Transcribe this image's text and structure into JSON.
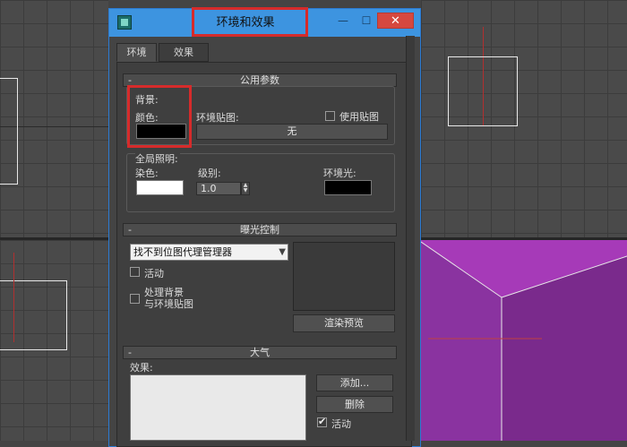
{
  "window": {
    "title": "环境和效果",
    "min_symbol": "—",
    "max_symbol": "☐",
    "close_symbol": "✕"
  },
  "tabs": [
    {
      "label": "环境",
      "active": true
    },
    {
      "label": "效果",
      "active": false
    }
  ],
  "common_params": {
    "header": "公用参数",
    "collapse_symbol": "-",
    "background_label": "背景:",
    "color_label": "颜色:",
    "env_map_label": "环境贴图:",
    "use_map_label": "使用贴图",
    "use_map_checked": false,
    "map_button": "无",
    "bg_color": "#000000",
    "global_lighting_label": "全局照明:",
    "tint_label": "染色:",
    "tint_color": "#ffffff",
    "level_label": "级别:",
    "level_value": "1.0",
    "ambient_label": "环境光:",
    "ambient_color": "#000000"
  },
  "exposure": {
    "header": "曝光控制",
    "collapse_symbol": "-",
    "dropdown_value": "找不到位图代理管理器",
    "active_label": "活动",
    "active_checked": false,
    "process_bg_label_1": "处理背景",
    "process_bg_label_2": "与环境贴图",
    "process_bg_checked": false,
    "render_preview_button": "渲染预览"
  },
  "atmosphere": {
    "header": "大气",
    "collapse_symbol": "-",
    "effects_label": "效果:",
    "add_button": "添加...",
    "delete_button": "删除",
    "active_label": "活动",
    "active_checked": true
  },
  "colors": {
    "titlebar": "#3d94e0",
    "highlight": "#d62b2b",
    "cube_front": "#7a2a8c",
    "cube_top": "#a63ab8"
  }
}
